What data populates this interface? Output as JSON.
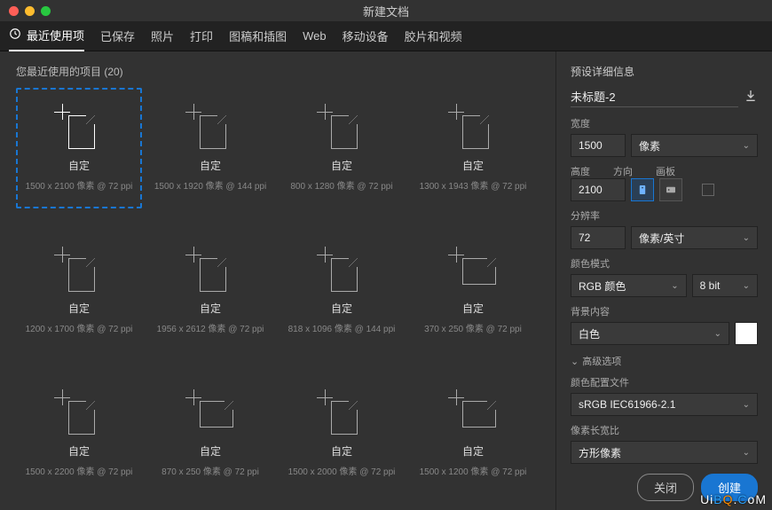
{
  "window": {
    "title": "新建文档"
  },
  "tabs": [
    {
      "label": "最近使用项",
      "active": true
    },
    {
      "label": "已保存"
    },
    {
      "label": "照片"
    },
    {
      "label": "打印"
    },
    {
      "label": "图稿和插图"
    },
    {
      "label": "Web"
    },
    {
      "label": "移动设备"
    },
    {
      "label": "胶片和视频"
    }
  ],
  "recent": {
    "heading": "您最近使用的项目  (20)",
    "items": [
      {
        "name": "自定",
        "dims": "1500 x 2100 像素 @ 72 ppi",
        "landscape": false,
        "selected": true
      },
      {
        "name": "自定",
        "dims": "1500 x 1920 像素 @ 144 ppi",
        "landscape": false
      },
      {
        "name": "自定",
        "dims": "800 x 1280 像素 @ 72 ppi",
        "landscape": false
      },
      {
        "name": "自定",
        "dims": "1300 x 1943 像素 @ 72 ppi",
        "landscape": false
      },
      {
        "name": "自定",
        "dims": "1200 x 1700 像素 @ 72 ppi",
        "landscape": false
      },
      {
        "name": "自定",
        "dims": "1956 x 2612 像素 @ 72 ppi",
        "landscape": false
      },
      {
        "name": "自定",
        "dims": "818 x 1096 像素 @ 144 ppi",
        "landscape": false
      },
      {
        "name": "自定",
        "dims": "370 x 250 像素 @ 72 ppi",
        "landscape": true
      },
      {
        "name": "自定",
        "dims": "1500 x 2200 像素 @ 72 ppi",
        "landscape": false
      },
      {
        "name": "自定",
        "dims": "870 x 250 像素 @ 72 ppi",
        "landscape": true
      },
      {
        "name": "自定",
        "dims": "1500 x 2000 像素 @ 72 ppi",
        "landscape": false
      },
      {
        "name": "自定",
        "dims": "1500 x 1200 像素 @ 72 ppi",
        "landscape": true
      }
    ]
  },
  "details": {
    "panel_title": "预设详细信息",
    "doc_name": "未标题-2",
    "width_label": "宽度",
    "width_value": "1500",
    "width_unit": "像素",
    "height_label": "高度",
    "height_value": "2100",
    "orient_label": "方向",
    "artboard_label": "画板",
    "res_label": "分辨率",
    "res_value": "72",
    "res_unit": "像素/英寸",
    "colormode_label": "颜色模式",
    "colormode_value": "RGB 颜色",
    "colorbits": "8 bit",
    "bg_label": "背景内容",
    "bg_value": "白色",
    "adv_label": "高级选项",
    "profile_label": "颜色配置文件",
    "profile_value": "sRGB IEC61966-2.1",
    "aspect_label": "像素长宽比",
    "aspect_value": "方形像素"
  },
  "footer": {
    "close": "关闭",
    "create": "创建"
  },
  "watermark": "UiBQ.CoM"
}
